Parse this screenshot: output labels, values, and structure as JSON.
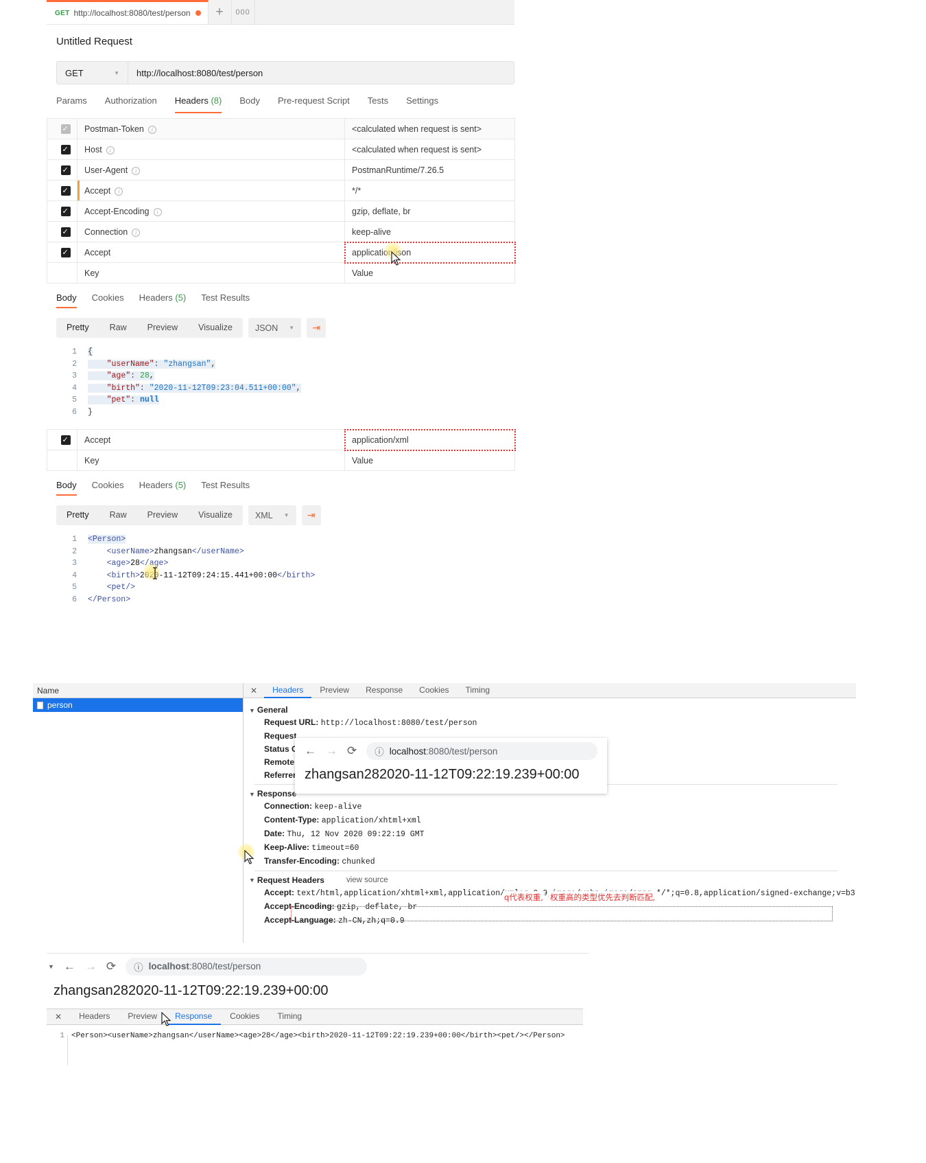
{
  "postman": {
    "tab": {
      "method": "GET",
      "url": "http://localhost:8080/test/person",
      "plus": "+",
      "more": "000"
    },
    "request_title": "Untitled Request",
    "method_selected": "GET",
    "url_value": "http://localhost:8080/test/person",
    "request_tabs": [
      {
        "label": "Params",
        "active": false
      },
      {
        "label": "Authorization",
        "active": false
      },
      {
        "label": "Headers",
        "count": "(8)",
        "active": true
      },
      {
        "label": "Body",
        "active": false
      },
      {
        "label": "Pre-request Script",
        "active": false
      },
      {
        "label": "Tests",
        "active": false
      },
      {
        "label": "Settings",
        "active": false
      }
    ],
    "headers_table_1": {
      "key_placeholder": "Key",
      "value_placeholder": "Value",
      "rows": [
        {
          "key": "Postman-Token",
          "value": "<calculated when request is sent>",
          "checked": true,
          "dim": true,
          "info": true
        },
        {
          "key": "Host",
          "value": "<calculated when request is sent>",
          "checked": true,
          "dim": false,
          "info": true
        },
        {
          "key": "User-Agent",
          "value": "PostmanRuntime/7.26.5",
          "checked": true,
          "dim": false,
          "info": true
        },
        {
          "key": "Accept",
          "value": "*/*",
          "checked": true,
          "dim": false,
          "info": true,
          "accent": true
        },
        {
          "key": "Accept-Encoding",
          "value": "gzip, deflate, br",
          "checked": true,
          "dim": false,
          "info": true
        },
        {
          "key": "Connection",
          "value": "keep-alive",
          "checked": true,
          "dim": false,
          "info": true
        },
        {
          "key": "Accept",
          "value": "application/json",
          "checked": true,
          "dim": false,
          "info": false,
          "highlight": true
        }
      ]
    },
    "response_1": {
      "tabs": [
        {
          "label": "Body",
          "active": true
        },
        {
          "label": "Cookies",
          "active": false
        },
        {
          "label": "Headers",
          "count": "(5)",
          "active": false
        },
        {
          "label": "Test Results",
          "active": false
        }
      ],
      "view_modes": [
        "Pretty",
        "Raw",
        "Preview",
        "Visualize"
      ],
      "view_active": "Pretty",
      "format": "JSON",
      "lines": [
        {
          "n": "1",
          "text": "{"
        },
        {
          "n": "2",
          "text": "    \"userName\": \"zhangsan\","
        },
        {
          "n": "3",
          "text": "    \"age\": 28,"
        },
        {
          "n": "4",
          "text": "    \"birth\": \"2020-11-12T09:23:04.511+00:00\","
        },
        {
          "n": "5",
          "text": "    \"pet\": null"
        },
        {
          "n": "6",
          "text": "}"
        }
      ]
    },
    "headers_table_2": {
      "key_placeholder": "Key",
      "value_placeholder": "Value",
      "rows": [
        {
          "key": "Accept",
          "value": "application/xml",
          "checked": true,
          "highlight": true
        }
      ]
    },
    "response_2": {
      "tabs": [
        {
          "label": "Body",
          "active": true
        },
        {
          "label": "Cookies",
          "active": false
        },
        {
          "label": "Headers",
          "count": "(5)",
          "active": false
        },
        {
          "label": "Test Results",
          "active": false
        }
      ],
      "view_modes": [
        "Pretty",
        "Raw",
        "Preview",
        "Visualize"
      ],
      "view_active": "Pretty",
      "format": "XML",
      "lines": [
        {
          "n": "1",
          "text": "<Person>"
        },
        {
          "n": "2",
          "text": "    <userName>zhangsan</userName>"
        },
        {
          "n": "3",
          "text": "    <age>28</age>"
        },
        {
          "n": "4",
          "text": "    <birth>2020-11-12T09:24:15.441+00:00</birth>"
        },
        {
          "n": "5",
          "text": "    <pet/>"
        },
        {
          "n": "6",
          "text": "</Person>"
        }
      ]
    }
  },
  "devtools": {
    "name_column_header": "Name",
    "request_name": "person",
    "tabs": [
      {
        "label": "Headers",
        "active": true
      },
      {
        "label": "Preview",
        "active": false
      },
      {
        "label": "Response",
        "active": false
      },
      {
        "label": "Cookies",
        "active": false
      },
      {
        "label": "Timing",
        "active": false
      }
    ],
    "close_label": "✕",
    "general": {
      "section": "General",
      "rows": [
        {
          "key": "Request URL:",
          "value": "http://localhost:8080/test/person"
        },
        {
          "key": "Request",
          "value": ""
        },
        {
          "key": "Status C",
          "value": ""
        },
        {
          "key": "Remote",
          "value": ""
        },
        {
          "key": "Referrer",
          "value": ""
        }
      ]
    },
    "response": {
      "section": "Response",
      "rows": [
        {
          "key": "Connection:",
          "value": "keep-alive"
        },
        {
          "key": "Content-Type:",
          "value": "application/xhtml+xml"
        },
        {
          "key": "Date:",
          "value": "Thu, 12 Nov 2020 09:22:19 GMT"
        },
        {
          "key": "Keep-Alive:",
          "value": "timeout=60"
        },
        {
          "key": "Transfer-Encoding:",
          "value": "chunked"
        }
      ]
    },
    "request_headers": {
      "section": "Request Headers",
      "view_source": "view source",
      "rows": [
        {
          "key": "Accept:",
          "value": "text/html,application/xhtml+xml,application/xml;q=0.9,image/webp,image/apng,*/*;q=0.8,application/signed-exchange;v=b3",
          "highlight": true
        },
        {
          "key": "Accept-Encoding:",
          "value": "gzip, deflate, br"
        },
        {
          "key": "Accept-Language:",
          "value": "zh-CN,zh;q=0.9"
        }
      ]
    }
  },
  "mini_browser": {
    "url_host": "localhost",
    "url_path": ":8080/test/person",
    "content": "zhangsan282020-11-12T09:22:19.239+00:00",
    "back_icon": "←",
    "forward_icon": "→",
    "reload_icon": "⟳",
    "info_icon": "ⓘ"
  },
  "bottom_browser": {
    "url_host": "localhost",
    "url_path": ":8080/test/person",
    "content": "zhangsan282020-11-12T09:22:19.239+00:00",
    "tabs": [
      {
        "label": "Headers",
        "active": false
      },
      {
        "label": "Preview",
        "active": false
      },
      {
        "label": "Response",
        "active": true
      },
      {
        "label": "Cookies",
        "active": false
      },
      {
        "label": "Timing",
        "active": false
      }
    ],
    "close_label": "✕",
    "code_line_number": "1",
    "code": "<Person><userName>zhangsan</userName><age>28</age><birth>2020-11-12T09:22:19.239+00:00</birth><pet/></Person>"
  },
  "annotations": {
    "weight_note_1": "q代表权重,",
    "weight_note_2": "权重高的类型优先去判断匹配,"
  },
  "colors": {
    "postman_accent": "#ff6c37",
    "devtools_accent": "#1a73e8",
    "annotation_red": "#e03131",
    "method_green": "#2f9e44"
  }
}
